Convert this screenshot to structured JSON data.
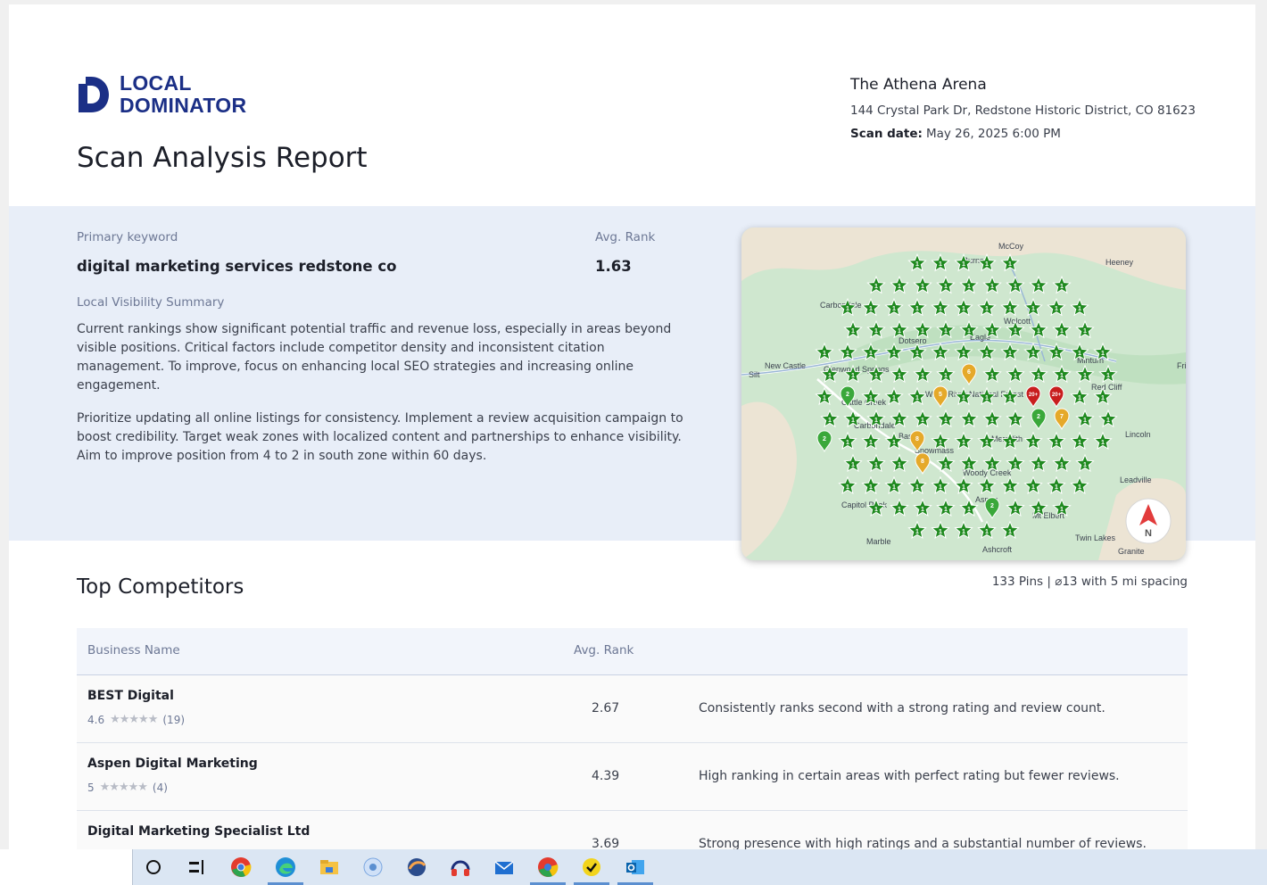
{
  "brand": {
    "line1": "LOCAL",
    "line2": "DOMINATOR",
    "color": "#1b2f86"
  },
  "report_title": "Scan Analysis Report",
  "business": {
    "name": "The Athena Arena",
    "address": "144 Crystal Park Dr, Redstone Historic District, CO 81623",
    "scan_date_label": "Scan date:",
    "scan_date": "May 26, 2025 6:00 PM"
  },
  "summary": {
    "keyword_label": "Primary keyword",
    "keyword": "digital marketing services redstone co",
    "avg_rank_label": "Avg. Rank",
    "avg_rank": "1.63",
    "visibility_label": "Local Visibility Summary",
    "paragraph1": "Current rankings show significant potential traffic and revenue loss, especially in areas beyond visible positions. Critical factors include competitor density and inconsistent citation management. To improve, focus on enhancing local SEO strategies and increasing online engagement.",
    "paragraph2": "Prioritize updating all online listings for consistency. Implement a review acquisition campaign to boost credibility. Target weak zones with localized content and partnerships to enhance visibility. Aim to improve position from 4 to 2 in south zone within 60 days."
  },
  "map": {
    "towns": [
      {
        "label": "McCoy"
      },
      {
        "label": "Burns"
      },
      {
        "label": "Heeney"
      },
      {
        "label": "Carbondale"
      },
      {
        "label": "Wolcott"
      },
      {
        "label": "Eagle"
      },
      {
        "label": "Dotsero"
      },
      {
        "label": "New Castle"
      },
      {
        "label": "Silt"
      },
      {
        "label": "Glenwood Springs"
      },
      {
        "label": "Frisco"
      },
      {
        "label": "Minturn"
      },
      {
        "label": "Red Cliff"
      },
      {
        "label": "White River National Forest"
      },
      {
        "label": "Cattle Creek"
      },
      {
        "label": "Carbondale"
      },
      {
        "label": "Basalt"
      },
      {
        "label": "Snowmass"
      },
      {
        "label": "Meredith"
      },
      {
        "label": "Woody Creek"
      },
      {
        "label": "Lincoln"
      },
      {
        "label": "Leadville"
      },
      {
        "label": "Capitol Peak"
      },
      {
        "label": "Aspen"
      },
      {
        "label": "Mt Elbert"
      },
      {
        "label": "Twin Lakes"
      },
      {
        "label": "Marble"
      },
      {
        "label": "Ashcroft"
      },
      {
        "label": "Granite"
      }
    ],
    "compass_label": "N",
    "pin_colors": {
      "rank1": "#1f8a1f",
      "rank2": "#3aa83a",
      "rank_mid": "#e5a92a",
      "rank_out": "#c81e1e"
    },
    "pins_summary": "133 Pins | ⌀13 with 5 mi spacing"
  },
  "competitors": {
    "heading": "Top Competitors",
    "columns": [
      "Business Name",
      "Avg. Rank"
    ],
    "rows": [
      {
        "name": "BEST Digital",
        "rating": "4.6",
        "reviews": "(19)",
        "avg_rank": "2.67",
        "note": "Consistently ranks second with a strong rating and review count."
      },
      {
        "name": "Aspen Digital Marketing",
        "rating": "5",
        "reviews": "(4)",
        "avg_rank": "4.39",
        "note": "High ranking in certain areas with perfect rating but fewer reviews."
      },
      {
        "name": "Digital Marketing Specialist Ltd",
        "rating": "",
        "reviews": "",
        "avg_rank": "3.69",
        "note": "Strong presence with high ratings and a substantial number of reviews."
      }
    ]
  },
  "taskbar": {
    "icons": [
      "cortana-icon",
      "task-view-icon",
      "chrome-icon",
      "edge-icon",
      "file-explorer-icon",
      "media-icon",
      "browser-globe-icon",
      "headphones-icon",
      "mail-icon",
      "chrome-profile-icon",
      "todo-icon",
      "outlook-icon"
    ]
  }
}
